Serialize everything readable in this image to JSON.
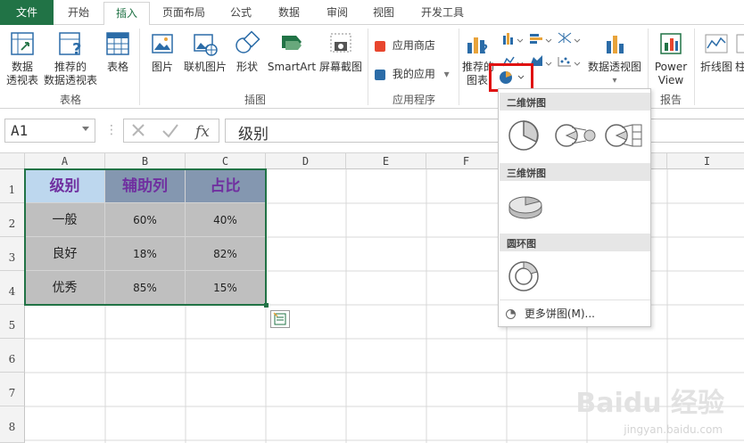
{
  "tabs": [
    "文件",
    "开始",
    "插入",
    "页面布局",
    "公式",
    "数据",
    "审阅",
    "视图",
    "开发工具"
  ],
  "ribbon": {
    "pivot_table": "数据\n透视表",
    "recommended_pivot": "推荐的\n数据透视表",
    "table": "表格",
    "group_tables": "表格",
    "pictures": "图片",
    "online_pictures": "联机图片",
    "shapes": "形状",
    "smartart": "SmartArt",
    "screenshot": "屏幕截图",
    "group_illustrations": "插图",
    "app_store": "应用商店",
    "my_apps": "我的应用",
    "group_apps": "应用程序",
    "recommended_charts": "推荐的\n图表",
    "pivot_chart": "数据透视图",
    "power_view": "Power\nView",
    "group_reports": "报告",
    "line_sparkline": "折线图",
    "column_sparkline": "柱"
  },
  "namebox": "A1",
  "formula_value": "级别",
  "columns": [
    "A",
    "B",
    "C",
    "D",
    "E",
    "F",
    "I"
  ],
  "rows": [
    "1",
    "2",
    "3",
    "4",
    "5",
    "6",
    "7",
    "8"
  ],
  "table": {
    "header": [
      "级别",
      "辅助列",
      "占比"
    ],
    "rows": [
      [
        "一般",
        "60%",
        "40%"
      ],
      [
        "良好",
        "18%",
        "82%"
      ],
      [
        "优秀",
        "85%",
        "15%"
      ]
    ]
  },
  "menu": {
    "section_2d": "二维饼图",
    "section_3d": "三维饼图",
    "section_donut": "圆环图",
    "more": "更多饼图(M)..."
  },
  "watermark": "Baidu 经验",
  "watermark_url": "jingyan.baidu.com",
  "colors": {
    "excel_green": "#217346",
    "header_fill_a": "#bdd7ee",
    "header_fill_bc": "#8497b0",
    "header_text": "#7030a0",
    "body_fill": "#bfbfbf",
    "highlight": "#e01010"
  }
}
